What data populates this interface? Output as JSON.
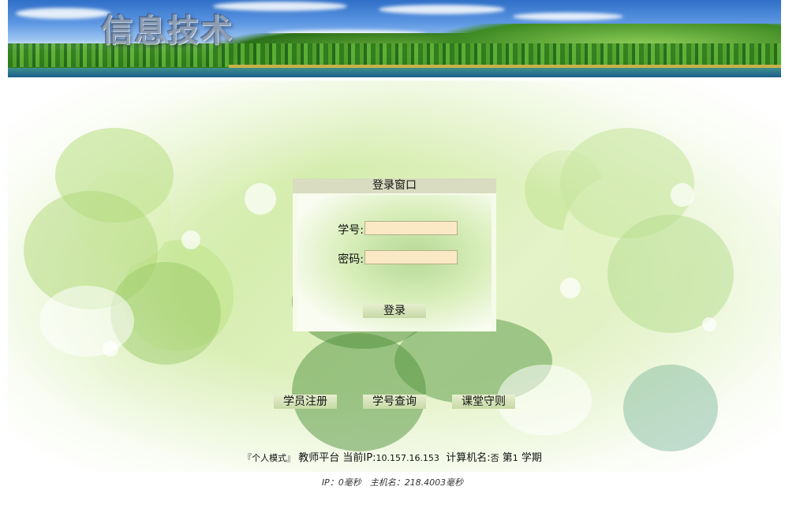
{
  "banner": {
    "logo_text": "信息技术"
  },
  "login": {
    "title": "登录窗口",
    "student_id_label": "学号:",
    "student_id_value": "",
    "password_label": "密码:",
    "password_value": "",
    "submit_label": "登录"
  },
  "links": [
    {
      "label": "学员注册"
    },
    {
      "label": "学号查询"
    },
    {
      "label": "课堂守则"
    }
  ],
  "status": {
    "mode": "『个人模式』",
    "platform": "教师平台",
    "ip_label": "当前IP:",
    "ip_value": "10.157.16.153",
    "computer_label": "计算机名:",
    "computer_value": "否",
    "term_prefix": "第",
    "term_number": "1",
    "term_suffix": "学期"
  },
  "timing": "IP：0毫秒　主机名：218.4003毫秒",
  "colors": {
    "input_bg": "#fbe9c6",
    "title_bar": "#d9dcc0",
    "button_bg": "#c7d9a6"
  }
}
